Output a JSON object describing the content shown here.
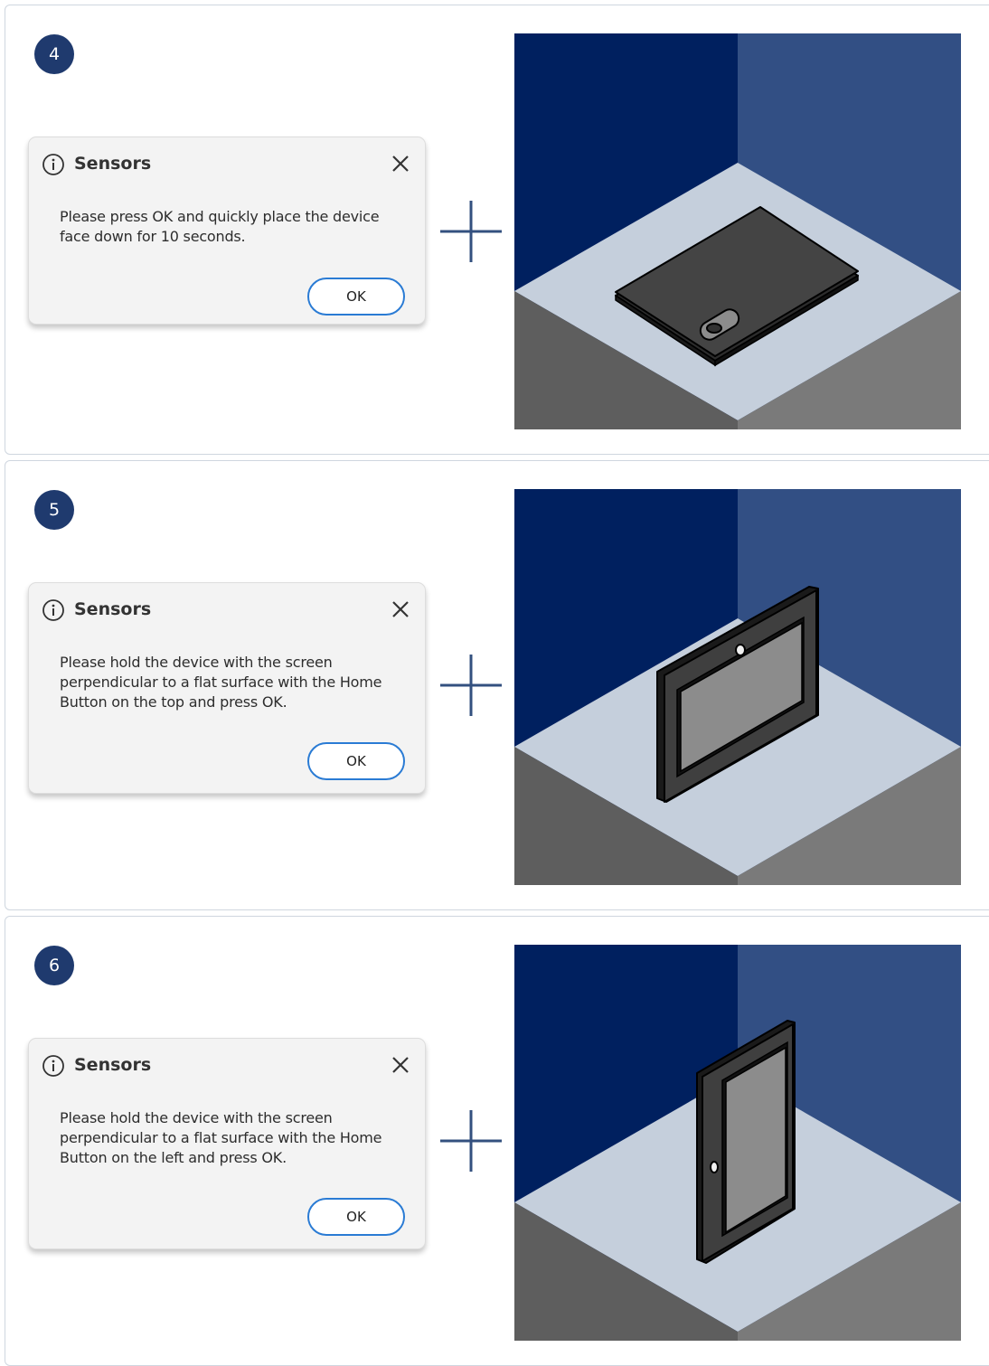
{
  "steps": [
    {
      "number": "4",
      "dialog": {
        "title": "Sensors",
        "message": "Please press OK and quickly place the device face down for 10 seconds.",
        "ok_label": "OK"
      },
      "illustration": "device-face-down"
    },
    {
      "number": "5",
      "dialog": {
        "title": "Sensors",
        "message": "Please hold the device with the screen perpendicular to a flat surface with the Home Button on the top and press OK.",
        "ok_label": "OK"
      },
      "illustration": "device-upright-landscape-home-top"
    },
    {
      "number": "6",
      "dialog": {
        "title": "Sensors",
        "message": "Please hold the device with the screen perpendicular to a flat surface with the Home Button on the left and press OK.",
        "ok_label": "OK"
      },
      "illustration": "device-upright-portrait-home-left"
    }
  ],
  "icons": {
    "info": "info-circle-icon",
    "close": "close-x-icon",
    "plus": "plus-icon"
  },
  "colors": {
    "badge": "#1f3a6e",
    "ok_border": "#2a7bd4",
    "wall_left": "#00205f",
    "wall_right": "#324f84",
    "floor": "#c5cfdc",
    "pedestal_left": "#5e5e5e",
    "pedestal_right": "#7a7a7a",
    "device": "#3f3f3f",
    "screen": "#8c8c8c",
    "plus": "#33507f"
  }
}
